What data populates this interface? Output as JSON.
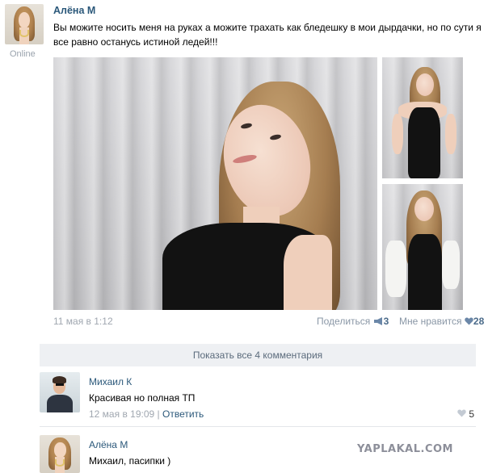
{
  "post": {
    "author": "Алёна М",
    "status": "Online",
    "text_line1": "Вы можите носить меня на руках а можите трахать как бледешку в мои дырдачки, но по сути я",
    "text_line2": "все равно останусь истиной ледей!!!",
    "date": "11 мая в 1:12",
    "share_label": "Поделиться",
    "share_count": "3",
    "like_label": "Мне нравится",
    "like_count": "28"
  },
  "show_comments_label": "Показать все 4 комментария",
  "comments": [
    {
      "author": "Михаил К",
      "text": "Красивая но полная ТП",
      "date": "12 мая в 19:09",
      "separator": "|",
      "reply_label": "Ответить",
      "likes": "5"
    },
    {
      "author": "Алёна М",
      "text": "Михаил, пасипки )"
    }
  ],
  "watermark": "YAPLAKAL.COM",
  "icons": {
    "share": "megaphone-icon",
    "like": "heart-icon"
  },
  "colors": {
    "link": "#2b587a",
    "meta": "#a0a7b0",
    "button_bg": "#eef0f3"
  }
}
